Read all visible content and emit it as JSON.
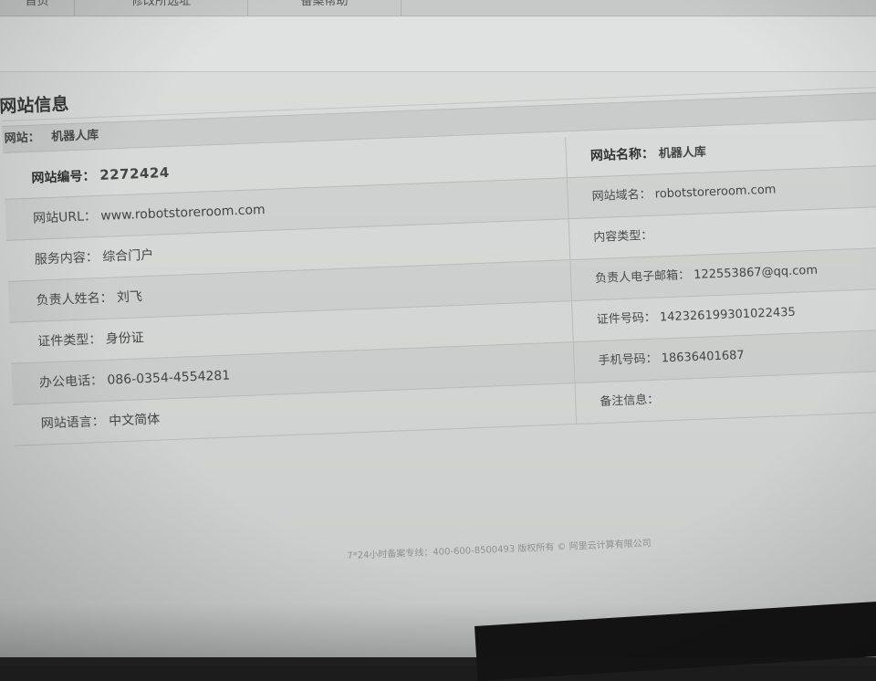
{
  "nav": {
    "tabs": [
      {
        "label": "首页"
      },
      {
        "label": "修改所选址"
      },
      {
        "label": "备案帮助"
      }
    ]
  },
  "panel": {
    "title": "网站信息",
    "site_label": "网站：",
    "site_name": "机器人库"
  },
  "left_rows": [
    {
      "label": "网站编号：",
      "value": "2272424"
    },
    {
      "label": "网站URL：",
      "value": "www.robotstoreroom.com"
    },
    {
      "label": "服务内容：",
      "value": "综合门户"
    },
    {
      "label": "负责人姓名：",
      "value": "刘飞"
    },
    {
      "label": "证件类型：",
      "value": "身份证"
    },
    {
      "label": "办公电话：",
      "value": "086-0354-4554281"
    },
    {
      "label": "网站语言：",
      "value": "中文简体"
    }
  ],
  "right_rows": [
    {
      "label": "网站名称：",
      "value": "机器人库"
    },
    {
      "label": "网站域名：",
      "value": "robotstoreroom.com"
    },
    {
      "label": "内容类型：",
      "value": ""
    },
    {
      "label": "负责人电子邮箱：",
      "value": "122553867@qq.com"
    },
    {
      "label": "证件号码：",
      "value": "142326199301022435"
    },
    {
      "label": "手机号码：",
      "value": "18636401687"
    },
    {
      "label": "备注信息：",
      "value": ""
    }
  ],
  "footer": {
    "text": "7*24小时备案专线：400-600-8500493 版权所有 © 阿里云计算有限公司"
  },
  "colors": {
    "background": "#d6d8d7",
    "header_bar": "#c9cccb",
    "text": "#444444",
    "rule": "#b8bbba"
  }
}
